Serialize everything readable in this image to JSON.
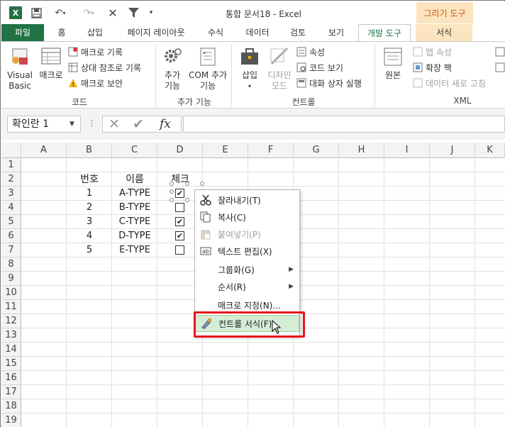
{
  "titlebar": {
    "app_icon": "excel-icon",
    "title": "통합 문서18 - Excel",
    "contextual_group": "그리기 도구"
  },
  "tabs": [
    {
      "label": "파일"
    },
    {
      "label": "홈"
    },
    {
      "label": "삽입"
    },
    {
      "label": "페이지 레이아웃"
    },
    {
      "label": "수식"
    },
    {
      "label": "데이터"
    },
    {
      "label": "검토"
    },
    {
      "label": "보기"
    },
    {
      "label": "개발 도구"
    },
    {
      "label": "서식"
    }
  ],
  "ribbon": {
    "code": {
      "label": "코드",
      "visual_basic": "Visual Basic",
      "macro": "매크로",
      "record_macro": "매크로 기록",
      "relative_ref": "상대 참조로 기록",
      "macro_security": "매크로 보안"
    },
    "addins": {
      "label": "추가 기능",
      "addins_btn": "추가 기능",
      "com_addins": "COM 추가 기능"
    },
    "controls": {
      "label": "컨트롤",
      "insert": "삽입",
      "design_mode": "디자인 모드",
      "properties": "속성",
      "view_code": "코드 보기",
      "run_dialog": "대화 상자 실행"
    },
    "xml": {
      "label": "XML",
      "source": "원본",
      "map_properties": "맵 속성",
      "expansion_pack": "확장 팩",
      "refresh_data": "데이터 새로 고침"
    }
  },
  "formula_bar": {
    "name_box": "확인란 1",
    "fx": "fx",
    "formula": ""
  },
  "grid": {
    "columns": [
      "A",
      "B",
      "C",
      "D",
      "E",
      "F",
      "G",
      "H",
      "I",
      "J",
      "K"
    ],
    "rows": [
      "1",
      "2",
      "3",
      "4",
      "5",
      "6",
      "7",
      "8",
      "9",
      "10",
      "11",
      "12",
      "13",
      "14",
      "15",
      "16",
      "17",
      "18",
      "19"
    ],
    "header_number": "번호",
    "header_name": "이름",
    "header_check": "체크",
    "data": [
      {
        "num": "1",
        "name": "A-TYPE",
        "checked": true
      },
      {
        "num": "2",
        "name": "B-TYPE",
        "checked": false
      },
      {
        "num": "3",
        "name": "C-TYPE",
        "checked": true
      },
      {
        "num": "4",
        "name": "D-TYPE",
        "checked": true
      },
      {
        "num": "5",
        "name": "E-TYPE",
        "checked": false
      }
    ],
    "check_mark": "✔"
  },
  "context_menu": {
    "cut": "잘라내기(T)",
    "copy": "복사(C)",
    "paste": "붙여넣기(P)",
    "edit_text": "텍스트 편집(X)",
    "grouping": "그룹화(G)",
    "order": "순서(R)",
    "assign_macro": "매크로 지정(N)...",
    "format_control": "컨트롤 서식(F)..."
  },
  "colors": {
    "excel_green": "#217346",
    "contextual_tab": "#fce4c0",
    "highlight_red": "#e8141b"
  }
}
